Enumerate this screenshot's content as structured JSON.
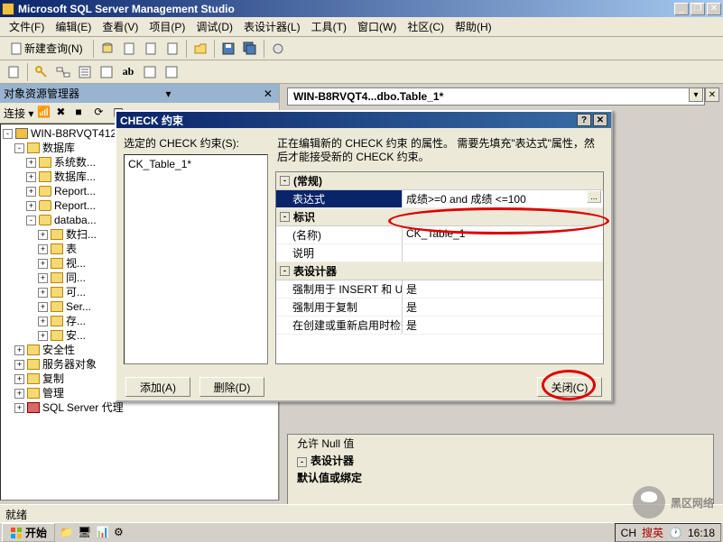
{
  "app_title": "Microsoft SQL Server Management Studio",
  "menu": [
    "文件(F)",
    "编辑(E)",
    "查看(V)",
    "项目(P)",
    "调试(D)",
    "表设计器(L)",
    "工具(T)",
    "窗口(W)",
    "社区(C)",
    "帮助(H)"
  ],
  "toolbars": {
    "new_query": "新建查询(N)"
  },
  "obj_explorer": {
    "title": "对象资源管理器",
    "connect": "连接 ▾",
    "server": "WIN-B8RVQT412...",
    "nodes": {
      "db": "数据库",
      "sysdb": "系统数...",
      "dbsnap": "数据库...",
      "report1": "Report...",
      "report2": "Report...",
      "userdb": "databa...",
      "dbdiag": "数扫...",
      "tables": "表",
      "views": "视...",
      "syn": "同...",
      "prog": "可...",
      "sb": "Ser...",
      "storage": "存...",
      "sec_db": "安...",
      "security": "安全性",
      "serverobj": "服务器对象",
      "replication": "复制",
      "management": "管理",
      "agent": "SQL Server 代理"
    }
  },
  "doc_tab": "WIN-B8RVQT4...dbo.Table_1*",
  "lower_panel": {
    "row1": "允许 Null 值",
    "cat1": "表设计器",
    "row2": "默认值或绑定"
  },
  "dialog": {
    "title": "CHECK 约束",
    "left_label": "选定的 CHECK 约束(S):",
    "list_item": "CK_Table_1*",
    "info": "正在编辑新的 CHECK 约束 的属性。 需要先填充\"表达式\"属性，然后才能接受新的 CHECK 约束。",
    "cat_general": "(常规)",
    "prop_expr": "表达式",
    "val_expr": "成绩>=0 and 成绩 <=100",
    "cat_identity": "标识",
    "prop_name": "(名称)",
    "val_name": "CK_Table_1",
    "prop_desc": "说明",
    "cat_designer": "表设计器",
    "prop_insert": "强制用于 INSERT 和 UPDATE",
    "val_insert": "是",
    "prop_repl": "强制用于复制",
    "val_repl": "是",
    "prop_check": "在创建或重新启用时检查现有数据",
    "val_check": "是",
    "btn_add": "添加(A)",
    "btn_delete": "删除(D)",
    "btn_close": "关闭(C)"
  },
  "statusbar": "就绪",
  "taskbar": {
    "start": "开始",
    "tray_lang": "CH",
    "tray_ime": "搜英",
    "tray_time": "16:18"
  },
  "watermark": "黑区网络"
}
